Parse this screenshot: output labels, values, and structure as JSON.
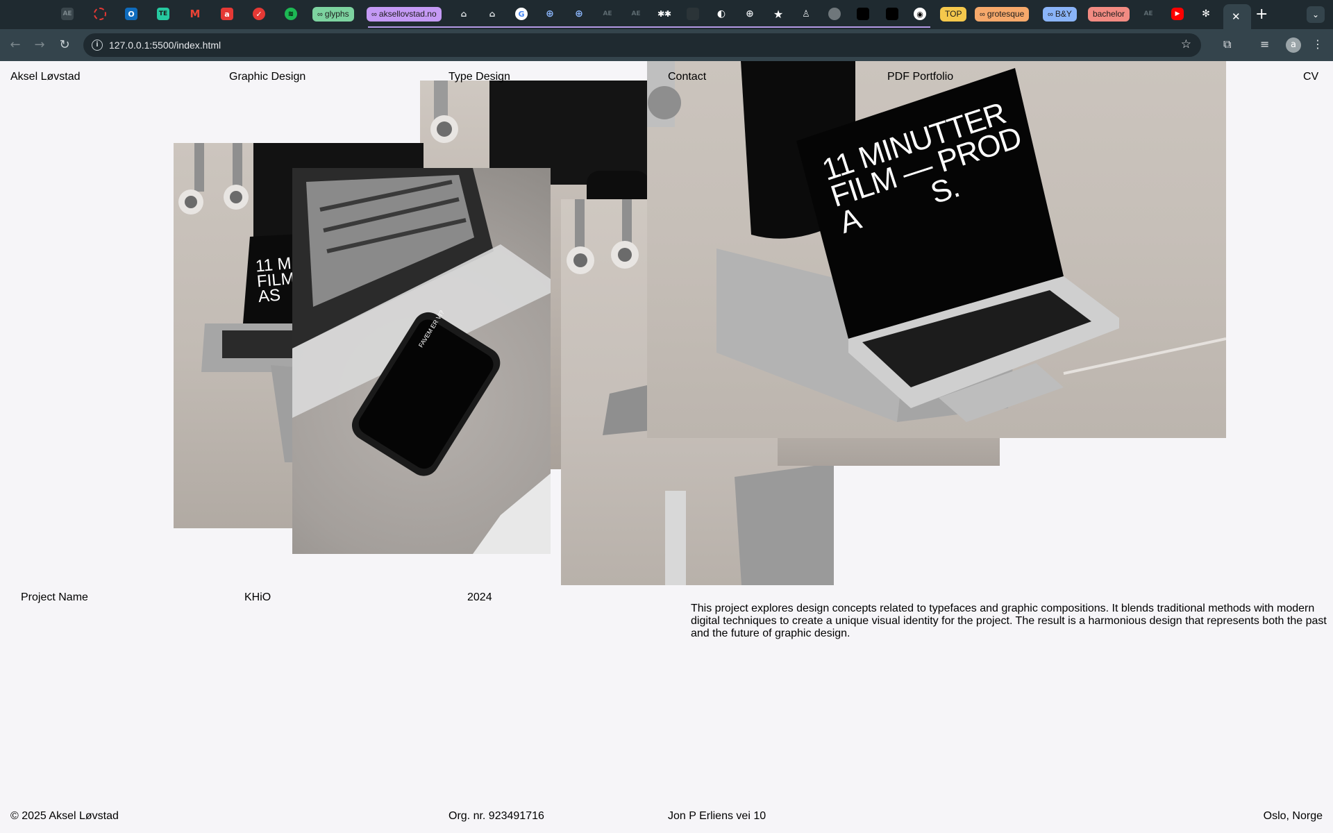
{
  "browser": {
    "tab_groups": {
      "glyphs": "glyphs",
      "aksel": "aksellovstad.no",
      "top": "TOP",
      "grotesque": "grotesque",
      "by": "B&Y",
      "bachelor": "bachelor"
    },
    "url": "127.0.0.1:5500/index.html",
    "profile_initial": "a",
    "colors": {
      "tabbar": "#1f2a30",
      "toolbar": "#34444c",
      "group_glyphs": "#7dd3a0",
      "group_aksel": "#c59af5",
      "group_top": "#f5c84c",
      "group_grotesque": "#f6a96b",
      "group_by": "#8ab4f8",
      "group_bachelor": "#f28b82"
    }
  },
  "site": {
    "nav": {
      "name": "Aksel Løvstad",
      "graphic_design": "Graphic Design",
      "type_design": "Type Design",
      "contact": "Contact",
      "pdf_portfolio": "PDF Portfolio",
      "cv": "CV"
    },
    "photos": {
      "laptop_back_left_screen": "11 M\nFILM\nAS",
      "phone_screen_header": "FAVEM ER VI?",
      "laptop_main_screen": "11 MINUTTER\nFILM — PROD\nA          S."
    },
    "project": {
      "name_label": "Project Name",
      "client": "KHiO",
      "year": "2024",
      "description": "This project explores design concepts related to typefaces and graphic compositions. It blends traditional methods with modern digital techniques to create a unique visual identity for the project. The result is a harmonious design that represents both the past and the future of graphic design."
    },
    "footer": {
      "copyright": "© 2025 Aksel Løvstad",
      "org": "Org. nr. 923491716",
      "address": "Jon P Erliens vei 10",
      "city": "Oslo, Norge"
    }
  }
}
